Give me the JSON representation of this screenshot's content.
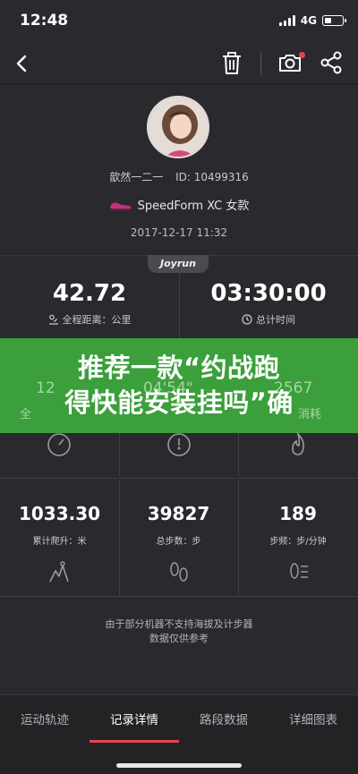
{
  "status_bar": {
    "time": "12:48",
    "network": "4G",
    "battery_level": 0.4
  },
  "toolbar": {
    "back_icon": "chevron-left-icon",
    "trash_icon": "trash-icon",
    "camera_icon": "camera-icon",
    "share_icon": "share-icon",
    "notification_dot_color": "#e8424b"
  },
  "profile": {
    "username": "歆然一二一",
    "user_id": "ID: 10499316",
    "shoe_name": "SpeedForm XC 女款",
    "date_time": "2017-12-17 11:32",
    "brand_tab": "Joyrun"
  },
  "summary": {
    "distance_value": "42.72",
    "distance_label": "全程距离：公里",
    "time_value": "03:30:00",
    "time_label": "总计时间"
  },
  "overlay": {
    "line1": "推荐一款“约战跑",
    "line2": "得快能安装挂吗”确",
    "background_color": "#3b9f3b",
    "peek_left": "12",
    "peek_mid": "04'54\"",
    "peek_right": "2567",
    "peek_left_label": "全",
    "peek_right_label": "消耗"
  },
  "grid": [
    {
      "value": "1033.30",
      "label": "累计爬升：米",
      "icon": "climb-icon"
    },
    {
      "value": "39827",
      "label": "总步数：步",
      "icon": "footprints-icon"
    },
    {
      "value": "189",
      "label": "步频：步/分钟",
      "icon": "step-frequency-icon"
    }
  ],
  "row_icons": [
    "speedometer-icon",
    "pace-gauge-icon",
    "flame-icon"
  ],
  "footnote": {
    "line1": "由于部分机器不支持海拔及计步器",
    "line2": "数据仅供参考"
  },
  "tabs": [
    {
      "label": "运动轨迹"
    },
    {
      "label": "记录详情"
    },
    {
      "label": "路段数据"
    },
    {
      "label": "详细图表"
    }
  ],
  "active_tab": "记录详情",
  "accent_color": "#e8424b"
}
